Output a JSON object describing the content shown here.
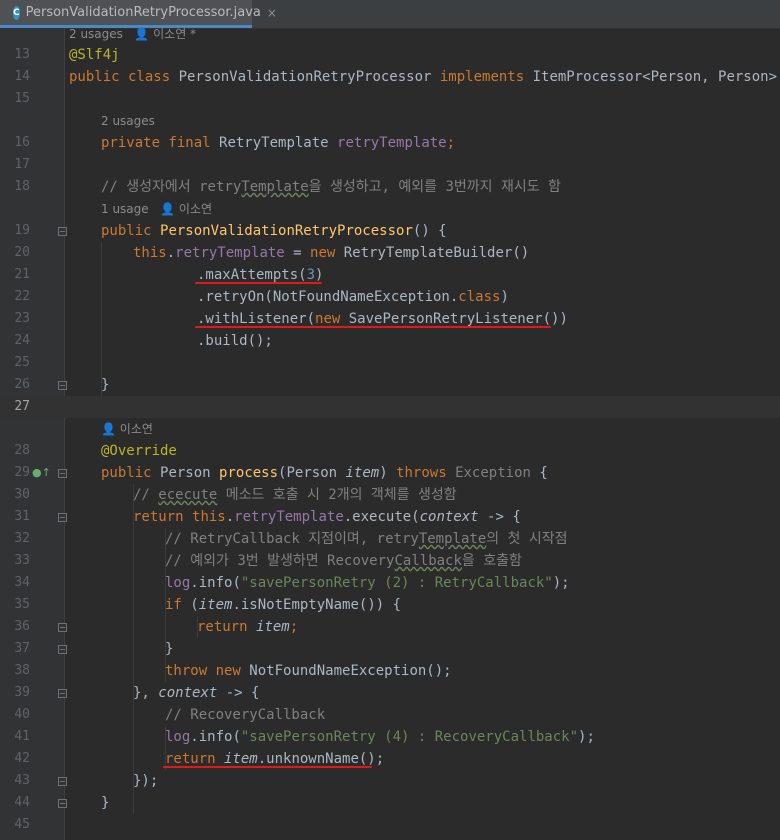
{
  "tab": {
    "filename": "PersonValidationRetryProcessor.java",
    "icon": "C",
    "close": "×"
  },
  "hints": {
    "class_usage": "2 usages   👤 이소연 *",
    "field_usage": "2 usages",
    "ctor_usage": "1 usage   👤 이소연",
    "process_author": "👤 이소연"
  },
  "line_numbers": [
    "13",
    "14",
    "15",
    "16",
    "17",
    "18",
    "19",
    "20",
    "21",
    "22",
    "23",
    "24",
    "25",
    "26",
    "27",
    "28",
    "29",
    "30",
    "31",
    "32",
    "33",
    "34",
    "35",
    "36",
    "37",
    "38",
    "39",
    "40",
    "41",
    "42",
    "43",
    "44",
    "45"
  ],
  "current_line": "27",
  "code": {
    "l13": "@Slf4j",
    "l14_kw1": "public class ",
    "l14_name": "PersonValidationRetryProcessor ",
    "l14_kw2": "implements ",
    "l14_rest": "ItemProcessor<Person, Person> {",
    "l16_kw": "private final ",
    "l16_type": "RetryTemplate ",
    "l16_field": "retryTemplate",
    "l16_end": ";",
    "l18_a": "// 생성자에서 retry",
    "l18_b": "Template",
    "l18_c": "을 생성하고, 예외를 3번까지 재시도 함",
    "l19_kw": "public ",
    "l19_name": "PersonValidationRetryProcessor",
    "l19_end": "() {",
    "l20_kw1": "this",
    "l20_dot": ".",
    "l20_field": "retryTemplate",
    "l20_eq": " = ",
    "l20_kw2": "new ",
    "l20_rest": "RetryTemplateBuilder()",
    "l21_a": ".maxAttempts(",
    "l21_num": "3",
    "l21_b": ")",
    "l22_a": ".retryOn(NotFoundNameException.",
    "l22_kw": "class",
    "l22_b": ")",
    "l23_a": ".withListener(",
    "l23_kw": "new ",
    "l23_b": "SavePersonRetryListener())",
    "l24": ".build();",
    "l26": "}",
    "l28": "@Override",
    "l29_kw": "public ",
    "l29_type": "Person ",
    "l29_name": "process",
    "l29_p1": "(Person ",
    "l29_param": "item",
    "l29_p2": ") ",
    "l29_throws": "throws ",
    "l29_exc": "Exception",
    "l29_end": " {",
    "l30_a": "// ",
    "l30_b": "ececute",
    "l30_c": " 메소드 호출 시 2개의 객체를 생성함",
    "l31_kw1": "return ",
    "l31_kw2": "this",
    "l31_dot": ".",
    "l31_field": "retryTemplate",
    "l31_a": ".execute(",
    "l31_param": "context",
    "l31_b": " -> {",
    "l32_a": "// RetryCallback 지점이며, retry",
    "l32_b": "Template",
    "l32_c": "의 첫 시작점",
    "l33_a": "// 예외가 3번 발생하면 Recovery",
    "l33_b": "Callback",
    "l33_c": "을 호출함",
    "l34_log": "log",
    "l34_a": ".info(",
    "l34_str": "\"savePersonRetry (2) : RetryCallback\"",
    "l34_b": ");",
    "l35_kw": "if ",
    "l35_a": "(",
    "l35_param": "item",
    "l35_b": ".isNotEmptyName()) {",
    "l36_kw": "return ",
    "l36_param": "item",
    "l36_b": ";",
    "l37": "}",
    "l38_kw1": "throw ",
    "l38_kw2": "new ",
    "l38_b": "NotFoundNameException();",
    "l39_a": "}, ",
    "l39_param": "context",
    "l39_b": " -> {",
    "l40": "// RecoveryCallback",
    "l41_log": "log",
    "l41_a": ".info(",
    "l41_str": "\"savePersonRetry (4) : RecoveryCallback\"",
    "l41_b": ");",
    "l42_kw": "return ",
    "l42_param": "item",
    "l42_b": ".unknownName();",
    "l43": "});",
    "l44": "}"
  },
  "colors": {
    "background": "#2b2b2b",
    "keyword": "#cc7832",
    "annotation": "#bbb529",
    "field": "#9876aa",
    "string": "#6a8759",
    "number": "#6897bb",
    "method": "#ffc66d",
    "comment": "#808080",
    "highlight_underline": "#e01a1a"
  },
  "gutter_icons": {
    "line29": "override-marker-icon"
  }
}
